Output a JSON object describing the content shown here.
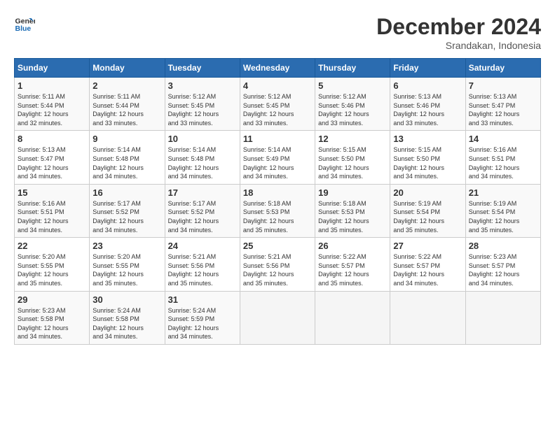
{
  "header": {
    "logo_line1": "General",
    "logo_line2": "Blue",
    "title": "December 2024",
    "subtitle": "Srandakan, Indonesia"
  },
  "calendar": {
    "days_of_week": [
      "Sunday",
      "Monday",
      "Tuesday",
      "Wednesday",
      "Thursday",
      "Friday",
      "Saturday"
    ],
    "weeks": [
      [
        {
          "day": "",
          "info": ""
        },
        {
          "day": "2",
          "info": "Sunrise: 5:11 AM\nSunset: 5:44 PM\nDaylight: 12 hours\nand 33 minutes."
        },
        {
          "day": "3",
          "info": "Sunrise: 5:12 AM\nSunset: 5:45 PM\nDaylight: 12 hours\nand 33 minutes."
        },
        {
          "day": "4",
          "info": "Sunrise: 5:12 AM\nSunset: 5:45 PM\nDaylight: 12 hours\nand 33 minutes."
        },
        {
          "day": "5",
          "info": "Sunrise: 5:12 AM\nSunset: 5:46 PM\nDaylight: 12 hours\nand 33 minutes."
        },
        {
          "day": "6",
          "info": "Sunrise: 5:13 AM\nSunset: 5:46 PM\nDaylight: 12 hours\nand 33 minutes."
        },
        {
          "day": "7",
          "info": "Sunrise: 5:13 AM\nSunset: 5:47 PM\nDaylight: 12 hours\nand 33 minutes."
        }
      ],
      [
        {
          "day": "1",
          "info": "Sunrise: 5:11 AM\nSunset: 5:44 PM\nDaylight: 12 hours\nand 32 minutes."
        },
        {
          "day": "9",
          "info": "Sunrise: 5:14 AM\nSunset: 5:48 PM\nDaylight: 12 hours\nand 34 minutes."
        },
        {
          "day": "10",
          "info": "Sunrise: 5:14 AM\nSunset: 5:48 PM\nDaylight: 12 hours\nand 34 minutes."
        },
        {
          "day": "11",
          "info": "Sunrise: 5:14 AM\nSunset: 5:49 PM\nDaylight: 12 hours\nand 34 minutes."
        },
        {
          "day": "12",
          "info": "Sunrise: 5:15 AM\nSunset: 5:50 PM\nDaylight: 12 hours\nand 34 minutes."
        },
        {
          "day": "13",
          "info": "Sunrise: 5:15 AM\nSunset: 5:50 PM\nDaylight: 12 hours\nand 34 minutes."
        },
        {
          "day": "14",
          "info": "Sunrise: 5:16 AM\nSunset: 5:51 PM\nDaylight: 12 hours\nand 34 minutes."
        }
      ],
      [
        {
          "day": "8",
          "info": "Sunrise: 5:13 AM\nSunset: 5:47 PM\nDaylight: 12 hours\nand 34 minutes."
        },
        {
          "day": "16",
          "info": "Sunrise: 5:17 AM\nSunset: 5:52 PM\nDaylight: 12 hours\nand 34 minutes."
        },
        {
          "day": "17",
          "info": "Sunrise: 5:17 AM\nSunset: 5:52 PM\nDaylight: 12 hours\nand 34 minutes."
        },
        {
          "day": "18",
          "info": "Sunrise: 5:18 AM\nSunset: 5:53 PM\nDaylight: 12 hours\nand 35 minutes."
        },
        {
          "day": "19",
          "info": "Sunrise: 5:18 AM\nSunset: 5:53 PM\nDaylight: 12 hours\nand 35 minutes."
        },
        {
          "day": "20",
          "info": "Sunrise: 5:19 AM\nSunset: 5:54 PM\nDaylight: 12 hours\nand 35 minutes."
        },
        {
          "day": "21",
          "info": "Sunrise: 5:19 AM\nSunset: 5:54 PM\nDaylight: 12 hours\nand 35 minutes."
        }
      ],
      [
        {
          "day": "15",
          "info": "Sunrise: 5:16 AM\nSunset: 5:51 PM\nDaylight: 12 hours\nand 34 minutes."
        },
        {
          "day": "23",
          "info": "Sunrise: 5:20 AM\nSunset: 5:55 PM\nDaylight: 12 hours\nand 35 minutes."
        },
        {
          "day": "24",
          "info": "Sunrise: 5:21 AM\nSunset: 5:56 PM\nDaylight: 12 hours\nand 35 minutes."
        },
        {
          "day": "25",
          "info": "Sunrise: 5:21 AM\nSunset: 5:56 PM\nDaylight: 12 hours\nand 35 minutes."
        },
        {
          "day": "26",
          "info": "Sunrise: 5:22 AM\nSunset: 5:57 PM\nDaylight: 12 hours\nand 35 minutes."
        },
        {
          "day": "27",
          "info": "Sunrise: 5:22 AM\nSunset: 5:57 PM\nDaylight: 12 hours\nand 34 minutes."
        },
        {
          "day": "28",
          "info": "Sunrise: 5:23 AM\nSunset: 5:57 PM\nDaylight: 12 hours\nand 34 minutes."
        }
      ],
      [
        {
          "day": "22",
          "info": "Sunrise: 5:20 AM\nSunset: 5:55 PM\nDaylight: 12 hours\nand 35 minutes."
        },
        {
          "day": "30",
          "info": "Sunrise: 5:24 AM\nSunset: 5:58 PM\nDaylight: 12 hours\nand 34 minutes."
        },
        {
          "day": "31",
          "info": "Sunrise: 5:24 AM\nSunset: 5:59 PM\nDaylight: 12 hours\nand 34 minutes."
        },
        {
          "day": "",
          "info": ""
        },
        {
          "day": "",
          "info": ""
        },
        {
          "day": "",
          "info": ""
        },
        {
          "day": "",
          "info": ""
        }
      ],
      [
        {
          "day": "29",
          "info": "Sunrise: 5:23 AM\nSunset: 5:58 PM\nDaylight: 12 hours\nand 34 minutes."
        },
        {
          "day": "",
          "info": ""
        },
        {
          "day": "",
          "info": ""
        },
        {
          "day": "",
          "info": ""
        },
        {
          "day": "",
          "info": ""
        },
        {
          "day": "",
          "info": ""
        },
        {
          "day": "",
          "info": ""
        }
      ]
    ]
  }
}
